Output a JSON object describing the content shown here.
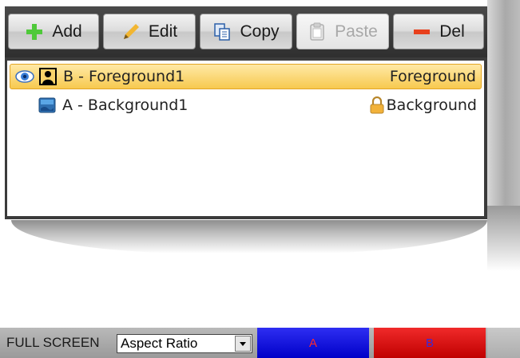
{
  "toolbar": {
    "add": {
      "label": "Add",
      "icon": "plus-icon"
    },
    "edit": {
      "label": "Edit",
      "icon": "pencil-icon"
    },
    "copy": {
      "label": "Copy",
      "icon": "copy-icon"
    },
    "paste": {
      "label": "Paste",
      "icon": "clipboard-icon",
      "disabled": true
    },
    "del": {
      "label": "Del",
      "icon": "minus-icon"
    }
  },
  "layers": [
    {
      "name": "B - Foreground1",
      "kind": "Foreground",
      "visible": true,
      "selected": true,
      "locked": false,
      "icon": "portrait-layer-icon"
    },
    {
      "name": "A - Background1",
      "kind": "Background",
      "visible": false,
      "selected": false,
      "locked": true,
      "icon": "image-layer-icon"
    }
  ],
  "bottom_bar": {
    "full_screen_label": "FULL SCREEN",
    "aspect_select_value": "Aspect Ratio",
    "swatch_a": {
      "label": "A",
      "color": "#0000d8",
      "text_color": "#ff2a2a"
    },
    "swatch_b": {
      "label": "B",
      "color": "#d80000",
      "text_color": "#3a2ad8"
    }
  },
  "colors": {
    "selection_fill": "#f7c94f",
    "toolbar_bg": "#3b3b3b"
  }
}
